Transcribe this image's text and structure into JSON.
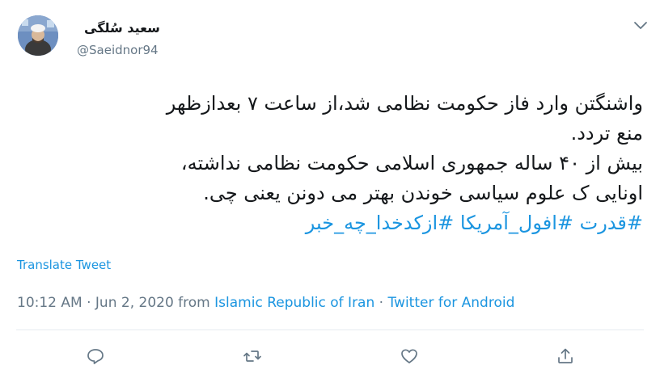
{
  "author": {
    "display_name": "سعید سُلگی",
    "handle": "@Saeidnor94"
  },
  "tweet": {
    "lines": [
      "واشنگتن وارد فاز حکومت نظامی شد،از ساعت ۷ بعدازظهر",
      "منع تردد.",
      "بیش از ۴۰ ساله جمهوری اسلامی حکومت نظامی نداشته،",
      "اونایی ک علوم سیاسی خوندن بهتر می دونن یعنی چی."
    ],
    "hashtags": "#قدرت #افول_آمریکا #ازکدخدا_چه_خبر"
  },
  "translate_label": "Translate Tweet",
  "meta": {
    "time": "10:12 AM",
    "separator1": " · ",
    "date": "Jun 2, 2020",
    "from_word": " from ",
    "location": "Islamic Republic of Iran",
    "separator2": " · ",
    "source": "Twitter for Android"
  },
  "icons": {
    "caret": "chevron-down-icon",
    "reply": "reply-icon",
    "retweet": "retweet-icon",
    "like": "heart-icon",
    "share": "share-icon"
  },
  "colors": {
    "link": "#1b95e0",
    "secondary_text": "#657786",
    "primary_text": "#14171a"
  }
}
